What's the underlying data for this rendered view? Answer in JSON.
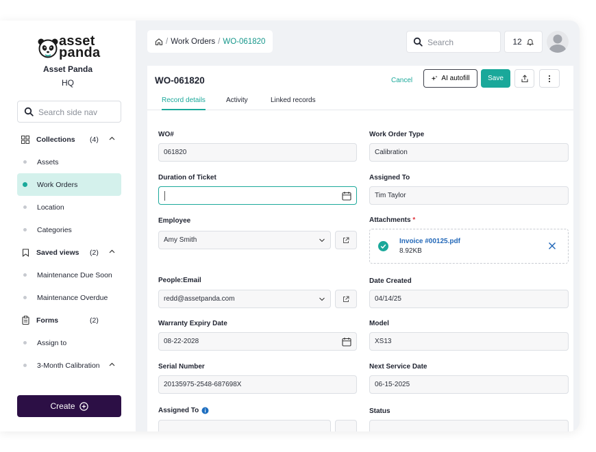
{
  "app": {
    "brand_line1": "asset",
    "brand_line2": "panda",
    "org_name": "Asset Panda",
    "org_sub": "HQ"
  },
  "sidebar": {
    "search_placeholder": "Search side nav",
    "items": [
      {
        "label": "Collections",
        "count": "(4)",
        "type": "section",
        "icon": "grid-icon"
      },
      {
        "label": "Assets",
        "type": "item"
      },
      {
        "label": "Work Orders",
        "type": "item",
        "active": true
      },
      {
        "label": "Location",
        "type": "item"
      },
      {
        "label": "Categories",
        "type": "item"
      },
      {
        "label": "Saved views",
        "count": "(2)",
        "type": "section",
        "icon": "bookmark-icon"
      },
      {
        "label": "Maintenance Due Soon",
        "type": "item"
      },
      {
        "label": "Maintenance Overdue",
        "type": "item"
      },
      {
        "label": "Forms",
        "count": "(2)",
        "type": "section",
        "icon": "clipboard-icon"
      },
      {
        "label": "Assign to",
        "type": "item"
      },
      {
        "label": "3-Month Calibration",
        "type": "item"
      }
    ],
    "create_label": "Create"
  },
  "header": {
    "breadcrumb": [
      "Work Orders",
      "WO-061820"
    ],
    "search_placeholder": "Search",
    "notification_count": "12"
  },
  "record": {
    "title": "WO-061820",
    "cancel_label": "Cancel",
    "ai_label": "AI autofill",
    "save_label": "Save",
    "tabs": [
      "Record details",
      "Activity",
      "Linked records"
    ],
    "fields": {
      "wo_label": "WO#",
      "wo_value": "061820",
      "type_label": "Work Order Type",
      "type_value": "Calibration",
      "duration_label": "Duration of Ticket",
      "duration_value": "",
      "assigned_label": "Assigned To",
      "assigned_value": "Tim Taylor",
      "employee_label": "Employee",
      "employee_value": "Amy Smith",
      "attachments_label": "Attachments",
      "attachments_required": "*",
      "attachment_name": "Invoice #00125.pdf",
      "attachment_size": "8.92KB",
      "email_label": "People:Email",
      "email_value": "redd@assetpanda.com",
      "date_created_label": "Date Created",
      "date_created_value": "04/14/25",
      "warranty_label": "Warranty Expiry Date",
      "warranty_value": "08-22-2028",
      "model_label": "Model",
      "model_value": "XS13",
      "serial_label": "Serial Number",
      "serial_value": "20135975-2548-687698X",
      "next_service_label": "Next Service Date",
      "next_service_value": "06-15-2025",
      "assigned2_label": "Assigned To",
      "status_label": "Status"
    }
  },
  "colors": {
    "accent": "#1aa89a",
    "create_bg": "#2c0f45",
    "link": "#2368b8",
    "required": "#e0303a",
    "info": "#1f6fc0"
  }
}
